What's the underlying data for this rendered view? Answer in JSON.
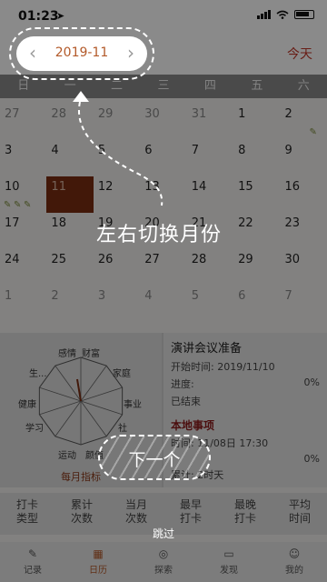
{
  "status": {
    "time": "01:23",
    "location_icon": "location-arrow"
  },
  "header": {
    "month": "2019-11",
    "today": "今天"
  },
  "weekdays": [
    "日",
    "一",
    "二",
    "三",
    "四",
    "五",
    "六"
  ],
  "calendar": {
    "rows": [
      [
        {
          "d": "27",
          "o": true
        },
        {
          "d": "28",
          "o": true
        },
        {
          "d": "29",
          "o": true
        },
        {
          "d": "30",
          "o": true
        },
        {
          "d": "31",
          "o": true
        },
        {
          "d": "1"
        },
        {
          "d": "2",
          "leaf": 1
        }
      ],
      [
        {
          "d": "3"
        },
        {
          "d": "4"
        },
        {
          "d": "5"
        },
        {
          "d": "6"
        },
        {
          "d": "7"
        },
        {
          "d": "8"
        },
        {
          "d": "9"
        }
      ],
      [
        {
          "d": "10",
          "leaf": 3
        },
        {
          "d": "11",
          "sel": true
        },
        {
          "d": "12"
        },
        {
          "d": "13"
        },
        {
          "d": "14"
        },
        {
          "d": "15"
        },
        {
          "d": "16"
        }
      ],
      [
        {
          "d": "17"
        },
        {
          "d": "18"
        },
        {
          "d": "19"
        },
        {
          "d": "20"
        },
        {
          "d": "21"
        },
        {
          "d": "22"
        },
        {
          "d": "23"
        }
      ],
      [
        {
          "d": "24"
        },
        {
          "d": "25"
        },
        {
          "d": "26"
        },
        {
          "d": "27"
        },
        {
          "d": "28"
        },
        {
          "d": "29"
        },
        {
          "d": "30"
        }
      ],
      [
        {
          "d": "1",
          "o": true
        },
        {
          "d": "2",
          "o": true
        },
        {
          "d": "3",
          "o": true
        },
        {
          "d": "4",
          "o": true
        },
        {
          "d": "5",
          "o": true
        },
        {
          "d": "6",
          "o": true
        },
        {
          "d": "7",
          "o": true
        }
      ]
    ]
  },
  "radar": {
    "labels": [
      "感情",
      "财富",
      "家庭",
      "事业",
      "社",
      "生...",
      "健康",
      "学习",
      "运动",
      "颜值"
    ],
    "footer": "每月指标"
  },
  "event": {
    "title": "演讲会议准备",
    "start": "开始时间: 2019/11/10",
    "progress_label": "进度:",
    "progress_pct": "0%",
    "state": "已结束",
    "section": "本地事项",
    "local_time": "时间: 11/08日 17:30",
    "local_pct": "0%",
    "total_days": "累计: 2时天"
  },
  "stats": [
    "打卡\n类型",
    "累计\n次数",
    "当月\n次数",
    "最早\n打卡",
    "最晚\n打卡",
    "平均\n时间"
  ],
  "tabs": [
    {
      "label": "记录",
      "icon": "✎"
    },
    {
      "label": "日历",
      "icon": "▦"
    },
    {
      "label": "探索",
      "icon": "◎"
    },
    {
      "label": "发现",
      "icon": "▭"
    },
    {
      "label": "我的",
      "icon": "☺"
    }
  ],
  "overlay": {
    "hint": "左右切换月份",
    "next": "下一个",
    "skip": "跳过"
  },
  "colors": {
    "accent": "#b35a2a",
    "selected_day": "#7a2d12",
    "today": "#c0392b"
  }
}
